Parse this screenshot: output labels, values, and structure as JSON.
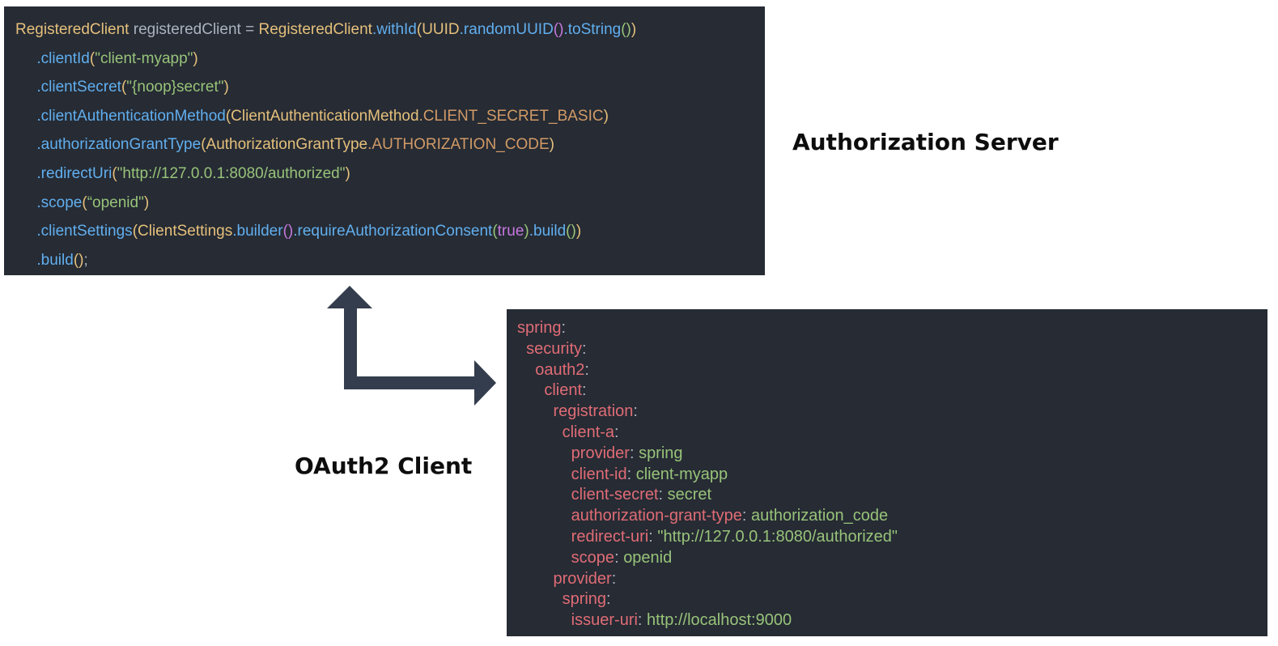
{
  "labels": {
    "authorization_server": "Authorization Server",
    "oauth2_client": "OAuth2 Client"
  },
  "colors": {
    "panel_bg": "#262b34",
    "class": "#e5c07b",
    "method": "#61afef",
    "string": "#98c379",
    "plain": "#abb2bf",
    "constant": "#d19a66",
    "keyword": "#c678dd",
    "yaml_key": "#e06c75",
    "arrow": "#333d4d"
  },
  "java_code": [
    [
      {
        "t": "RegisteredClient",
        "c": "class"
      },
      {
        "t": " registeredClient = ",
        "c": "plain"
      },
      {
        "t": "RegisteredClient",
        "c": "class"
      },
      {
        "t": ".withId",
        "c": "method"
      },
      {
        "t": "(",
        "c": "class"
      },
      {
        "t": "UUID",
        "c": "class"
      },
      {
        "t": ".randomUUID",
        "c": "method"
      },
      {
        "t": "()",
        "c": "keyword"
      },
      {
        "t": ".toString",
        "c": "method"
      },
      {
        "t": "()",
        "c": "string"
      },
      {
        "t": ")",
        "c": "class"
      }
    ],
    [
      {
        "t": "     .clientId",
        "c": "method"
      },
      {
        "t": "(",
        "c": "class"
      },
      {
        "t": "\"client-myapp\"",
        "c": "string"
      },
      {
        "t": ")",
        "c": "class"
      }
    ],
    [
      {
        "t": "     .clientSecret",
        "c": "method"
      },
      {
        "t": "(",
        "c": "class"
      },
      {
        "t": "\"{noop}secret\"",
        "c": "string"
      },
      {
        "t": ")",
        "c": "class"
      }
    ],
    [
      {
        "t": "     .clientAuthenticationMethod",
        "c": "method"
      },
      {
        "t": "(",
        "c": "class"
      },
      {
        "t": "ClientAuthenticationMethod",
        "c": "class"
      },
      {
        "t": ".CLIENT_SECRET_BASIC",
        "c": "constant"
      },
      {
        "t": ")",
        "c": "class"
      }
    ],
    [
      {
        "t": "     .authorizationGrantType",
        "c": "method"
      },
      {
        "t": "(",
        "c": "class"
      },
      {
        "t": "AuthorizationGrantType",
        "c": "class"
      },
      {
        "t": ".AUTHORIZATION_CODE",
        "c": "constant"
      },
      {
        "t": ")",
        "c": "class"
      }
    ],
    [
      {
        "t": "     .redirectUri",
        "c": "method"
      },
      {
        "t": "(",
        "c": "class"
      },
      {
        "t": "\"http://127.0.0.1:8080/authorized\"",
        "c": "string"
      },
      {
        "t": ")",
        "c": "class"
      }
    ],
    [
      {
        "t": "     .scope",
        "c": "method"
      },
      {
        "t": "(",
        "c": "class"
      },
      {
        "t": "“openid\"",
        "c": "string"
      },
      {
        "t": ")",
        "c": "class"
      }
    ],
    [
      {
        "t": "     .clientSettings",
        "c": "method"
      },
      {
        "t": "(",
        "c": "class"
      },
      {
        "t": "ClientSettings",
        "c": "class"
      },
      {
        "t": ".builder",
        "c": "method"
      },
      {
        "t": "()",
        "c": "keyword"
      },
      {
        "t": ".requireAuthorizationConsent",
        "c": "method"
      },
      {
        "t": "(",
        "c": "string"
      },
      {
        "t": "true",
        "c": "keyword"
      },
      {
        "t": ")",
        "c": "string"
      },
      {
        "t": ".build",
        "c": "method"
      },
      {
        "t": "()",
        "c": "string"
      },
      {
        "t": ")",
        "c": "class"
      }
    ],
    [
      {
        "t": "     .build",
        "c": "method"
      },
      {
        "t": "()",
        "c": "class"
      },
      {
        "t": ";",
        "c": "plain"
      }
    ]
  ],
  "yaml_code": [
    [
      {
        "t": "spring",
        "c": "yaml_key"
      },
      {
        "t": ":",
        "c": "plain"
      }
    ],
    [
      {
        "t": "  security",
        "c": "yaml_key"
      },
      {
        "t": ":",
        "c": "plain"
      }
    ],
    [
      {
        "t": "    oauth2",
        "c": "yaml_key"
      },
      {
        "t": ":",
        "c": "plain"
      }
    ],
    [
      {
        "t": "      client",
        "c": "yaml_key"
      },
      {
        "t": ":",
        "c": "plain"
      }
    ],
    [
      {
        "t": "        registration",
        "c": "yaml_key"
      },
      {
        "t": ":",
        "c": "plain"
      }
    ],
    [
      {
        "t": "          client-a",
        "c": "yaml_key"
      },
      {
        "t": ":",
        "c": "plain"
      }
    ],
    [
      {
        "t": "            provider",
        "c": "yaml_key"
      },
      {
        "t": ": ",
        "c": "plain"
      },
      {
        "t": "spring",
        "c": "string"
      }
    ],
    [
      {
        "t": "            client-id",
        "c": "yaml_key"
      },
      {
        "t": ": ",
        "c": "plain"
      },
      {
        "t": "client-myapp",
        "c": "string"
      }
    ],
    [
      {
        "t": "            client-secret",
        "c": "yaml_key"
      },
      {
        "t": ": ",
        "c": "plain"
      },
      {
        "t": "secret",
        "c": "string"
      }
    ],
    [
      {
        "t": "            authorization-grant-type",
        "c": "yaml_key"
      },
      {
        "t": ": ",
        "c": "plain"
      },
      {
        "t": "authorization_code",
        "c": "string"
      }
    ],
    [
      {
        "t": "            redirect-uri",
        "c": "yaml_key"
      },
      {
        "t": ": ",
        "c": "plain"
      },
      {
        "t": "\"http://127.0.0.1:8080/authorized\"",
        "c": "string"
      }
    ],
    [
      {
        "t": "            scope",
        "c": "yaml_key"
      },
      {
        "t": ": ",
        "c": "plain"
      },
      {
        "t": "openid",
        "c": "string"
      }
    ],
    [
      {
        "t": "        provider",
        "c": "yaml_key"
      },
      {
        "t": ":",
        "c": "plain"
      }
    ],
    [
      {
        "t": "          spring",
        "c": "yaml_key"
      },
      {
        "t": ":",
        "c": "plain"
      }
    ],
    [
      {
        "t": "            issuer-uri",
        "c": "yaml_key"
      },
      {
        "t": ": ",
        "c": "plain"
      },
      {
        "t": "http://localhost:9000",
        "c": "string"
      }
    ]
  ]
}
